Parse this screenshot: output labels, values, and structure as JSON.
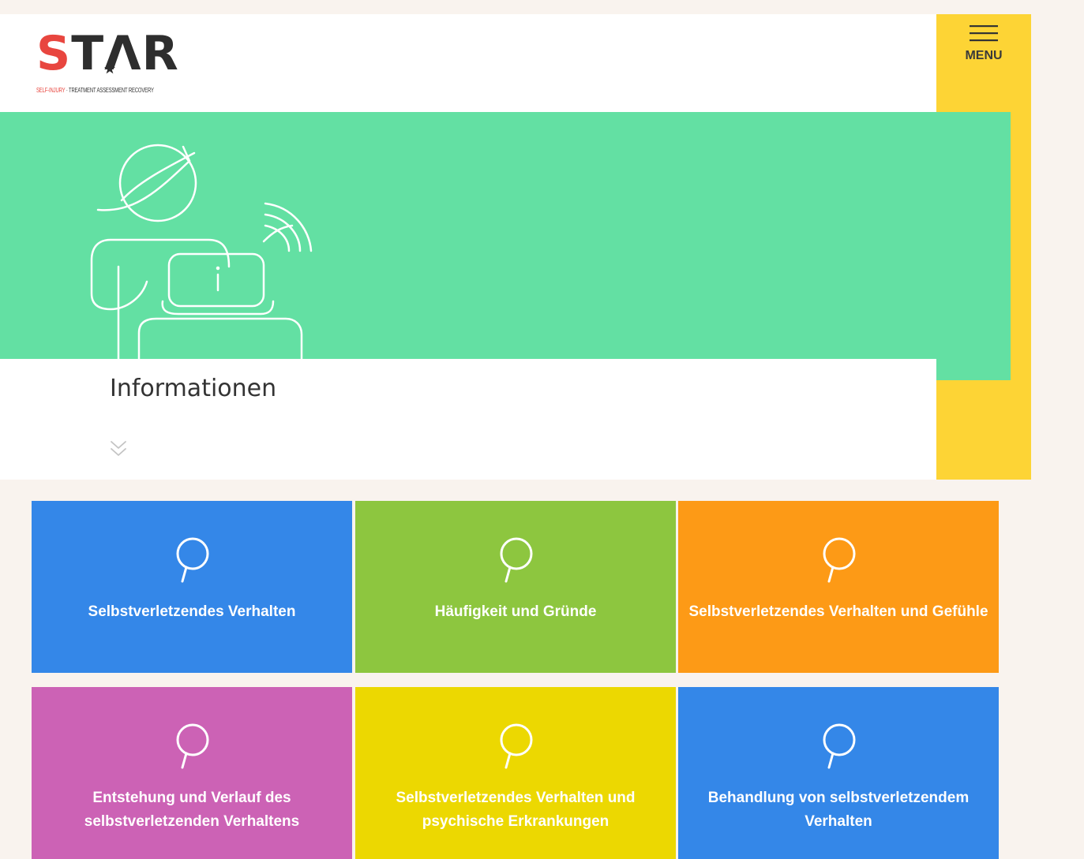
{
  "logo": {
    "word_s": "S",
    "word_rest": "TΛR",
    "tag_red": "SELF-INJURY",
    "tag_rest": " · TREATMENT ASSESSMENT RECOVERY"
  },
  "menu": {
    "label": "MENU"
  },
  "hero": {
    "title": "Informationen"
  },
  "tiles": [
    {
      "lines": [
        "Selbstverletzendes Verhalten"
      ],
      "color": "#3487e8"
    },
    {
      "lines": [
        "Häufigkeit und Gründe"
      ],
      "color": "#8dc63f"
    },
    {
      "lines": [
        "Selbstverletzendes Verhalten und Gefühle"
      ],
      "color": "#fd9a16"
    },
    {
      "lines": [
        "Entstehung und Verlauf des",
        "selbstverletzenden Verhaltens"
      ],
      "color": "#cc62b5"
    },
    {
      "lines": [
        "Selbstverletzendes Verhalten und",
        "psychische Erkrankungen"
      ],
      "color": "#ecd801"
    },
    {
      "lines": [
        "Behandlung von selbstverletzendem",
        "Verhalten"
      ],
      "color": "#3487e8"
    }
  ],
  "colors": {
    "page_bg": "#f9f3ee",
    "hero_green": "#63e0a3",
    "menu_yellow": "#fdd435",
    "logo_red": "#e8463f"
  },
  "icons": {
    "menu": "hamburger-icon",
    "tile": "magnifier-icon",
    "scroll": "chevron-down-double-icon",
    "hero": "person-with-laptop-illustration"
  }
}
